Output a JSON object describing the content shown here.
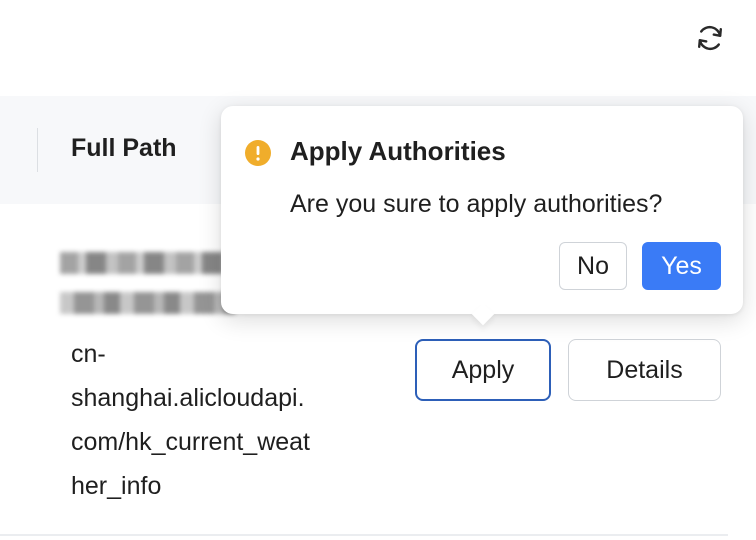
{
  "toolbar": {
    "refresh_icon": "refresh-icon"
  },
  "table": {
    "columns": [
      "Full Path"
    ],
    "rows": [
      {
        "full_path_lines": [
          "cn-",
          "shanghai.alicloudapi.",
          "com/hk_current_weat",
          "her_info"
        ],
        "actions": {
          "apply_label": "Apply",
          "details_label": "Details"
        }
      }
    ]
  },
  "popconfirm": {
    "icon": "warning-icon",
    "icon_color": "#f0ad2b",
    "title": "Apply Authorities",
    "description": "Are you sure to apply authorities?",
    "no_label": "No",
    "yes_label": "Yes",
    "primary_color": "#3a7bf6"
  }
}
